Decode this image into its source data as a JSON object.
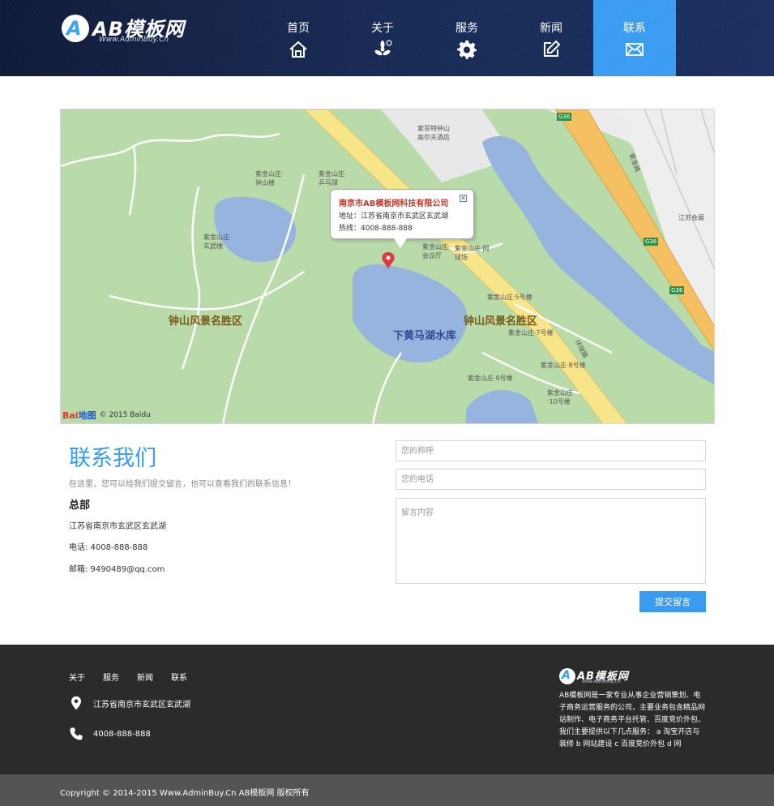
{
  "logo": {
    "mark": "A",
    "title": "AB模板网",
    "sub": "Www.AdminBuy.Cn"
  },
  "nav": {
    "items": [
      {
        "label": "首页",
        "icon": "home-icon"
      },
      {
        "label": "关于",
        "icon": "about-icon"
      },
      {
        "label": "服务",
        "icon": "gear-icon"
      },
      {
        "label": "新闻",
        "icon": "edit-icon"
      },
      {
        "label": "联系",
        "icon": "mail-icon"
      }
    ],
    "active_index": 4,
    "active_color": "#3a9cf1"
  },
  "map": {
    "labels": {
      "area_left": "钟山风景名胜区",
      "area_right": "钟山风景名胜区",
      "lake": "下黄马湖水库",
      "poi_1": "索菲特钟山高尔夫酒店",
      "poi_2": "紫金山庄·钟山楼",
      "poi_3": "紫金山庄·乒乓球",
      "poi_4": "紫金山庄·玄武楼",
      "poi_5": "紫金山庄·会议厅",
      "poi_6": "紫金山庄·网球场",
      "poi_7": "紫金山庄·5号楼",
      "poi_8": "紫金山庄·7号楼",
      "poi_9": "紫金山庄·8号楼",
      "poi_10": "紫金山庄·9号楼",
      "poi_11": "紫金山庄·10号楼",
      "poi_12": "江苏会展",
      "road_1": "G36",
      "road_2": "环陵路",
      "road_3": "紫金路"
    },
    "popup": {
      "title": "南京市AB模板网科技有限公司",
      "address": "地址：江苏省南京市玄武区玄武湖",
      "hotline": "热线：4008-888-888",
      "close": "✕"
    },
    "credit": {
      "brand_a": "Bai",
      "brand_b": "地图",
      "text": "© 2015 Baidu"
    }
  },
  "contact": {
    "title": "联系我们",
    "desc": "在这里，您可以给我们提交留言，也可以查看我们的联系信息！",
    "hq_title": "总部",
    "address": "江苏省南京市玄武区玄武湖",
    "phone": "电话: 4008-888-888",
    "email": "邮箱: 9490489@qq.com"
  },
  "form": {
    "name_placeholder": "您的称呼",
    "phone_placeholder": "您的电话",
    "message_placeholder": "留言内容",
    "submit_label": "提交留言"
  },
  "footer": {
    "links": [
      "关于",
      "服务",
      "新闻",
      "联系"
    ],
    "address": "江苏省南京市玄武区玄武湖",
    "phone": "4008-888-888",
    "about": "AB模板网是一家专业从事企业营销策划、电子商务运营服务的公司，主要业务包含精品网站制作、电子商务平台托管、百度竞价外包、 我们主要提供以下几点服务： a 淘宝开店与装修 b 网站建设 c 百度竞价外包 d 网",
    "copyright": "Copyright © 2014-2015 Www.AdminBuy.Cn AB模板网 版权所有"
  }
}
